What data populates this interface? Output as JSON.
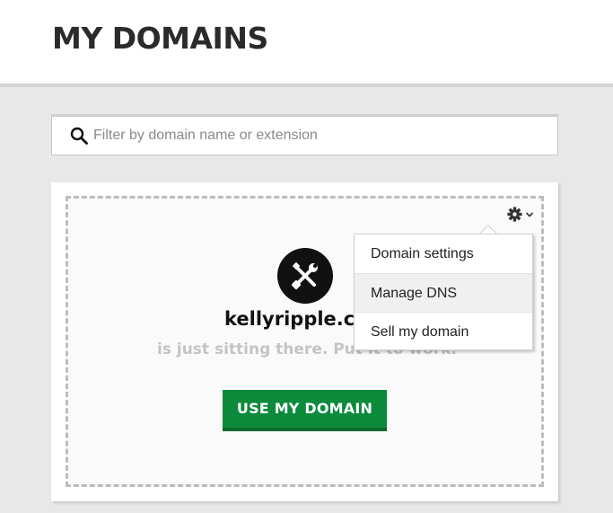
{
  "header": {
    "title": "MY DOMAINS"
  },
  "search": {
    "placeholder": "Filter by domain name or extension",
    "value": ""
  },
  "card": {
    "domain": "kellyripple.c",
    "tagline": "is just sitting there. Put it to work.",
    "cta_label": "USE MY DOMAIN",
    "settings_icon": "gear-icon",
    "menu": {
      "items": [
        {
          "label": "Domain settings",
          "highlighted": false
        },
        {
          "label": "Manage DNS",
          "highlighted": true
        },
        {
          "label": "Sell my domain",
          "highlighted": false
        }
      ]
    }
  },
  "colors": {
    "accent": "#0b8a3c",
    "header_bg": "#ffffff",
    "page_bg": "#e8e8e8"
  }
}
